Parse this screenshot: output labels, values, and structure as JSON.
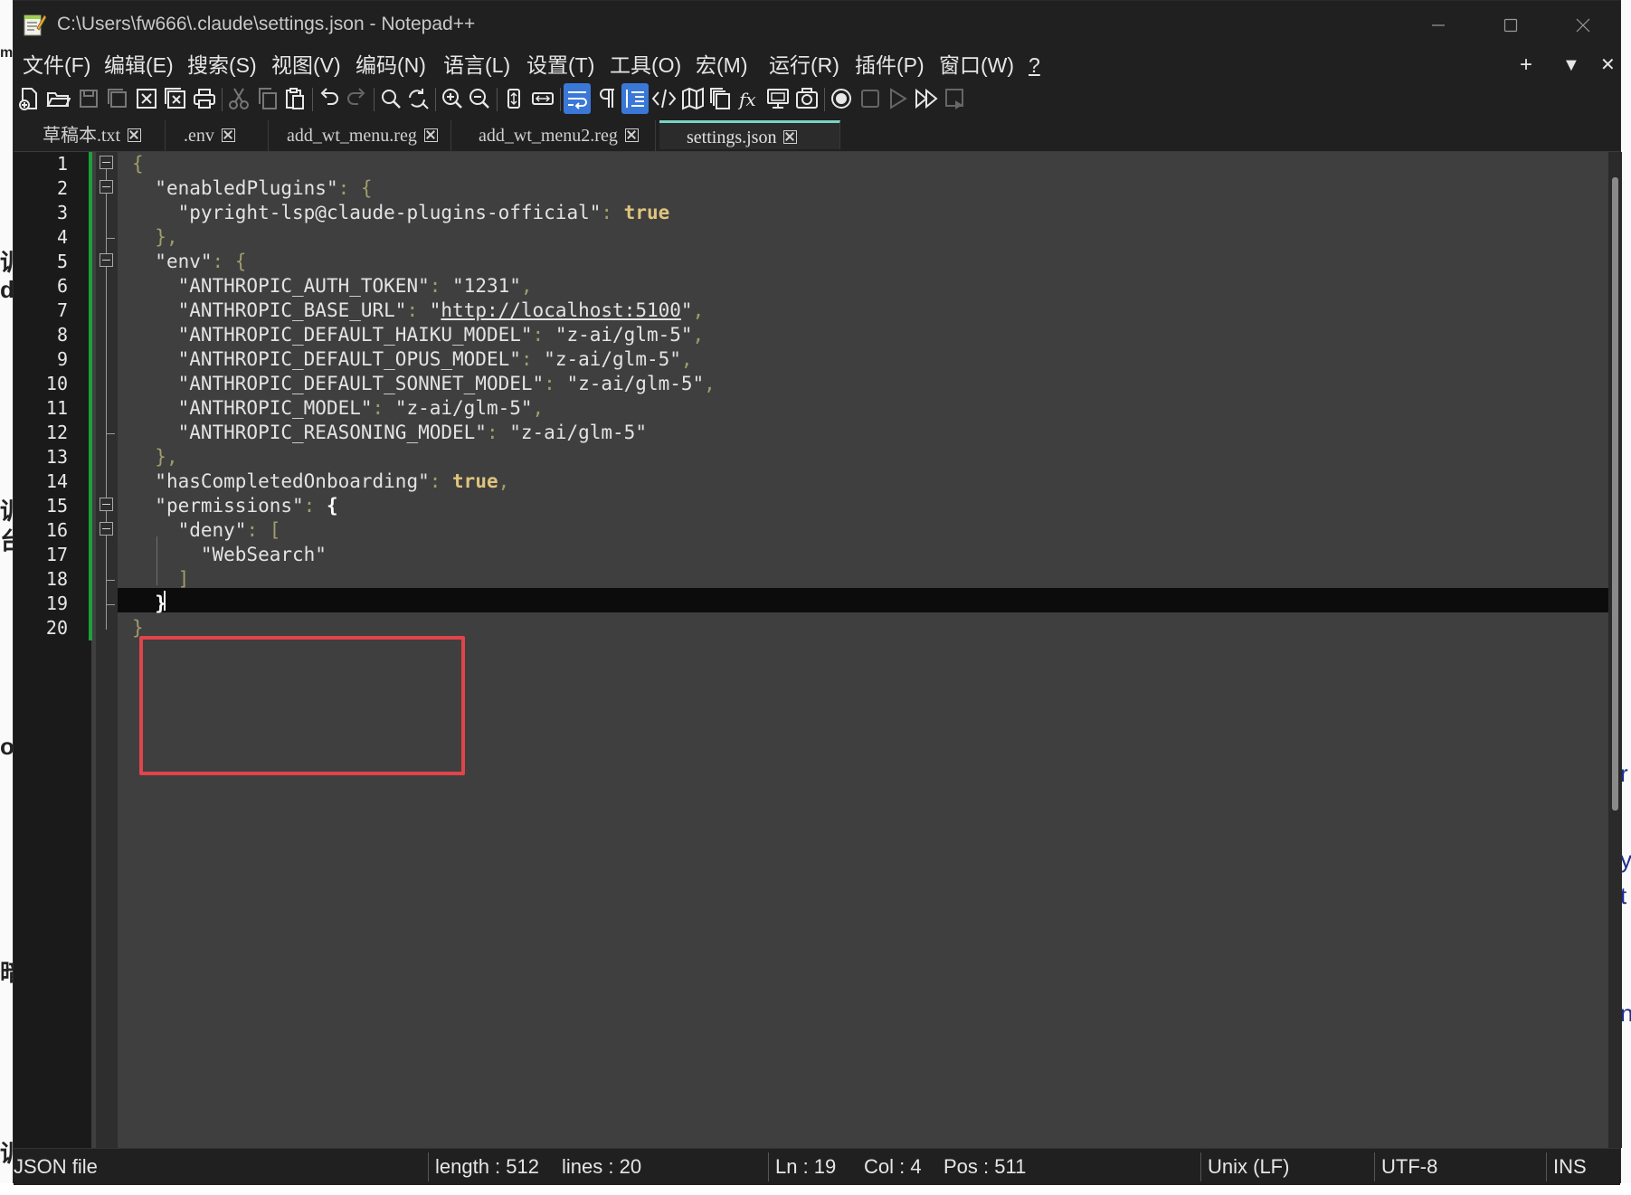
{
  "window": {
    "title": "C:\\Users\\fw666\\.claude\\settings.json - Notepad++"
  },
  "menubar": {
    "items": [
      "文件(F)",
      "编辑(E)",
      "搜索(S)",
      "视图(V)",
      "编码(N)",
      "语言(L)",
      "设置(T)",
      "工具(O)",
      "宏(M)",
      "运行(R)",
      "插件(P)",
      "窗口(W)",
      "?"
    ],
    "right": [
      "+",
      "▼",
      "✕"
    ]
  },
  "toolbar": {
    "icons": [
      "new-file-icon",
      "open-file-icon",
      "save-icon",
      "save-all-icon",
      "close-icon",
      "close-all-icon",
      "print-icon",
      "cut-icon",
      "copy-icon",
      "paste-icon",
      "undo-icon",
      "redo-icon",
      "find-icon",
      "replace-icon",
      "zoom-in-icon",
      "zoom-out-icon",
      "sync-vertical-icon",
      "sync-horizontal-icon",
      "word-wrap-icon",
      "show-all-chars-icon",
      "indent-guide-icon",
      "xml-tag-icon",
      "document-map-icon",
      "document-list-icon",
      "function-list-icon",
      "folder-workspace-icon",
      "monitoring-icon",
      "record-macro-icon",
      "stop-macro-icon",
      "play-macro-icon",
      "run-macro-multiple-icon",
      "save-macro-icon"
    ],
    "active": [
      "word-wrap-icon",
      "indent-guide-icon"
    ]
  },
  "tabs": [
    {
      "label": "草稿本.txt",
      "active": false
    },
    {
      "label": ".env",
      "active": false
    },
    {
      "label": "add_wt_menu.reg",
      "active": false
    },
    {
      "label": "add_wt_menu2.reg",
      "active": false
    },
    {
      "label": "settings.json",
      "active": true
    }
  ],
  "editor": {
    "line_numbers": [
      "1",
      "2",
      "3",
      "4",
      "5",
      "6",
      "7",
      "8",
      "9",
      "10",
      "11",
      "12",
      "13",
      "14",
      "15",
      "16",
      "17",
      "18",
      "19",
      "20"
    ],
    "current_line": 19,
    "lines": [
      {
        "indent": "",
        "parts": [
          {
            "t": "{",
            "c": "op"
          }
        ]
      },
      {
        "indent": "  ",
        "parts": [
          {
            "t": "\"enabledPlugins\"",
            "c": "k"
          },
          {
            "t": ": {",
            "c": "op"
          }
        ]
      },
      {
        "indent": "    ",
        "parts": [
          {
            "t": "\"pyright-lsp@claude-plugins-official\"",
            "c": "k"
          },
          {
            "t": ": ",
            "c": "op"
          },
          {
            "t": "true",
            "c": "b"
          }
        ]
      },
      {
        "indent": "  ",
        "parts": [
          {
            "t": "},",
            "c": "op"
          }
        ]
      },
      {
        "indent": "  ",
        "parts": [
          {
            "t": "\"env\"",
            "c": "k"
          },
          {
            "t": ": {",
            "c": "op"
          }
        ]
      },
      {
        "indent": "    ",
        "parts": [
          {
            "t": "\"ANTHROPIC_AUTH_TOKEN\"",
            "c": "k"
          },
          {
            "t": ": ",
            "c": "op"
          },
          {
            "t": "\"1231\"",
            "c": "s"
          },
          {
            "t": ",",
            "c": "op"
          }
        ]
      },
      {
        "indent": "    ",
        "parts": [
          {
            "t": "\"ANTHROPIC_BASE_URL\"",
            "c": "k"
          },
          {
            "t": ": ",
            "c": "op"
          },
          {
            "t": "\"",
            "c": "s"
          },
          {
            "t": "http://localhost:5100",
            "c": "s u"
          },
          {
            "t": "\"",
            "c": "s"
          },
          {
            "t": ",",
            "c": "op"
          }
        ]
      },
      {
        "indent": "    ",
        "parts": [
          {
            "t": "\"ANTHROPIC_DEFAULT_HAIKU_MODEL\"",
            "c": "k"
          },
          {
            "t": ": ",
            "c": "op"
          },
          {
            "t": "\"z-ai/glm-5\"",
            "c": "s"
          },
          {
            "t": ",",
            "c": "op"
          }
        ]
      },
      {
        "indent": "    ",
        "parts": [
          {
            "t": "\"ANTHROPIC_DEFAULT_OPUS_MODEL\"",
            "c": "k"
          },
          {
            "t": ": ",
            "c": "op"
          },
          {
            "t": "\"z-ai/glm-5\"",
            "c": "s"
          },
          {
            "t": ",",
            "c": "op"
          }
        ]
      },
      {
        "indent": "    ",
        "parts": [
          {
            "t": "\"ANTHROPIC_DEFAULT_SONNET_MODEL\"",
            "c": "k"
          },
          {
            "t": ": ",
            "c": "op"
          },
          {
            "t": "\"z-ai/glm-5\"",
            "c": "s"
          },
          {
            "t": ",",
            "c": "op"
          }
        ]
      },
      {
        "indent": "    ",
        "parts": [
          {
            "t": "\"ANTHROPIC_MODEL\"",
            "c": "k"
          },
          {
            "t": ": ",
            "c": "op"
          },
          {
            "t": "\"z-ai/glm-5\"",
            "c": "s"
          },
          {
            "t": ",",
            "c": "op"
          }
        ]
      },
      {
        "indent": "    ",
        "parts": [
          {
            "t": "\"ANTHROPIC_REASONING_MODEL\"",
            "c": "k"
          },
          {
            "t": ": ",
            "c": "op"
          },
          {
            "t": "\"z-ai/glm-5\"",
            "c": "s"
          }
        ]
      },
      {
        "indent": "  ",
        "parts": [
          {
            "t": "},",
            "c": "op"
          }
        ]
      },
      {
        "indent": "  ",
        "parts": [
          {
            "t": "\"hasCompletedOnboarding\"",
            "c": "k"
          },
          {
            "t": ": ",
            "c": "op"
          },
          {
            "t": "true",
            "c": "b"
          },
          {
            "t": ",",
            "c": "op"
          }
        ]
      },
      {
        "indent": "  ",
        "parts": [
          {
            "t": "\"permissions\"",
            "c": "k"
          },
          {
            "t": ": ",
            "c": "op"
          },
          {
            "t": "{",
            "c": "brace"
          }
        ]
      },
      {
        "indent": "    ",
        "parts": [
          {
            "t": "\"deny\"",
            "c": "k"
          },
          {
            "t": ": [",
            "c": "op"
          }
        ]
      },
      {
        "indent": "      ",
        "parts": [
          {
            "t": "\"WebSearch\"",
            "c": "s"
          }
        ]
      },
      {
        "indent": "    ",
        "parts": [
          {
            "t": "]",
            "c": "op"
          }
        ]
      },
      {
        "indent": "  ",
        "parts": [
          {
            "t": "}",
            "c": "brace"
          }
        ]
      },
      {
        "indent": "",
        "parts": [
          {
            "t": "}",
            "c": "op"
          }
        ]
      }
    ]
  },
  "statusbar": {
    "file_type": "JSON file",
    "length": "length : 512",
    "lines": "lines : 20",
    "ln": "Ln : 19",
    "col": "Col : 4",
    "pos": "Pos : 511",
    "eol": "Unix (LF)",
    "encoding": "UTF-8",
    "mode": "INS"
  },
  "colors": {
    "accent_tab": "#7ad3c4",
    "highlight_box": "#e0444c",
    "change_bar": "#1ca03c",
    "keyword_true": "#dfc47d"
  }
}
